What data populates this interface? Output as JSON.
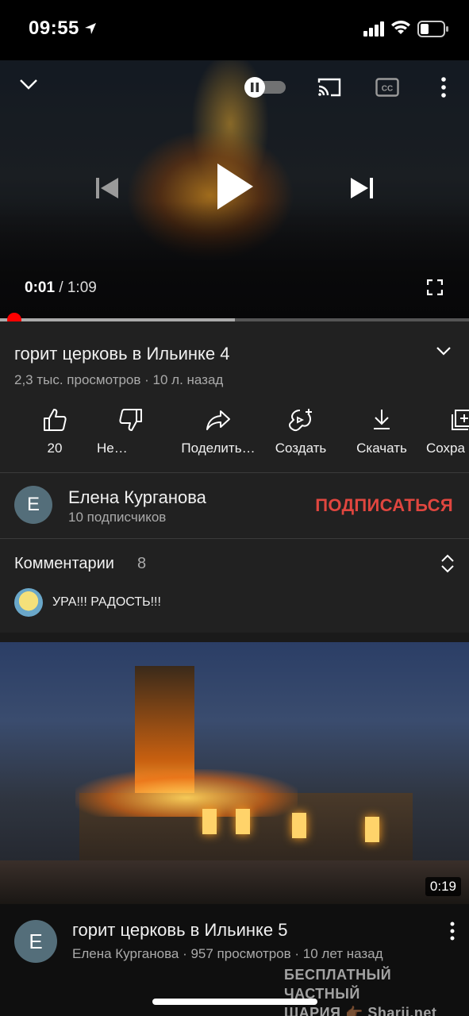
{
  "status_bar": {
    "time": "09:55"
  },
  "player": {
    "current_time": "0:01",
    "duration": "/ 1:09",
    "progress_fraction": 0.015,
    "buffer_fraction": 0.5
  },
  "video": {
    "title": "горит церковь в Ильинке 4",
    "meta": "2,3 тыс. просмотров · 10 л. назад"
  },
  "actions": [
    {
      "label": "20",
      "icon": "thumbs-up-icon"
    },
    {
      "label": "Не…",
      "icon": "thumbs-down-icon"
    },
    {
      "label": "Поделить…",
      "icon": "share-icon"
    },
    {
      "label": "Создать",
      "icon": "create-icon"
    },
    {
      "label": "Скачать",
      "icon": "download-icon"
    },
    {
      "label": "Сохра",
      "icon": "save-icon"
    }
  ],
  "channel": {
    "avatar_letter": "E",
    "name": "Елена Курганова",
    "subscribers": "10 подписчиков",
    "subscribe_label": "ПОДПИСАТЬСЯ"
  },
  "comments": {
    "title": "Комментарии",
    "count": "8",
    "top_comment": "УРА!!! РАДОСТЬ!!!"
  },
  "next_video": {
    "duration": "0:19",
    "avatar_letter": "E",
    "title": "горит церковь в Ильинке 5",
    "meta": "Елена Курганова · 957 просмотров · 10 лет назад"
  },
  "watermark": {
    "line1": "БЕСПЛАТНЫЙ ЧАСТНЫЙ",
    "line2": "ШАРИЯ 👉🏾 Sharij.net"
  },
  "colors": {
    "accent_red": "#ff0000",
    "subscribe_red": "#e0463f",
    "surface": "#212121"
  }
}
